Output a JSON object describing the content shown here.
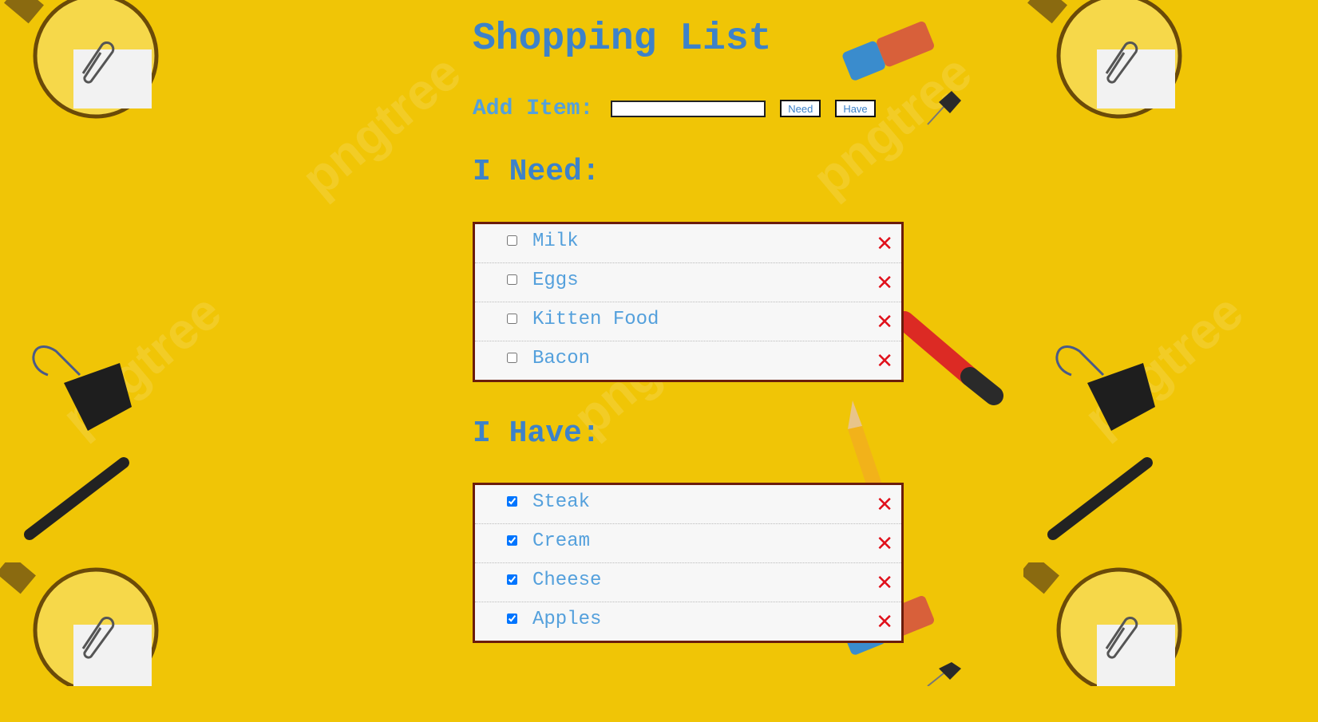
{
  "page": {
    "title": "Shopping List"
  },
  "add_item": {
    "label": "Add Item:",
    "input_value": "",
    "need_button": "Need",
    "have_button": "Have"
  },
  "need": {
    "heading": "I Need:",
    "items": [
      {
        "label": "Milk",
        "checked": false
      },
      {
        "label": "Eggs",
        "checked": false
      },
      {
        "label": "Kitten Food",
        "checked": false
      },
      {
        "label": "Bacon",
        "checked": false
      }
    ]
  },
  "have": {
    "heading": "I Have:",
    "items": [
      {
        "label": "Steak",
        "checked": true
      },
      {
        "label": "Cream",
        "checked": true
      },
      {
        "label": "Cheese",
        "checked": true
      },
      {
        "label": "Apples",
        "checked": true
      }
    ]
  },
  "delete_glyph": "✕",
  "colors": {
    "background": "#f0c506",
    "heading": "#3d82c9",
    "item_text": "#54a0dc",
    "delete": "#e0101b",
    "list_border": "#6b1d0c"
  },
  "icons": [
    "magnifier-icon",
    "paperclip-icon",
    "binder-clip-icon",
    "marker-icon",
    "eraser-icon",
    "pushpin-icon",
    "red-marker-icon",
    "pencil-icon"
  ]
}
